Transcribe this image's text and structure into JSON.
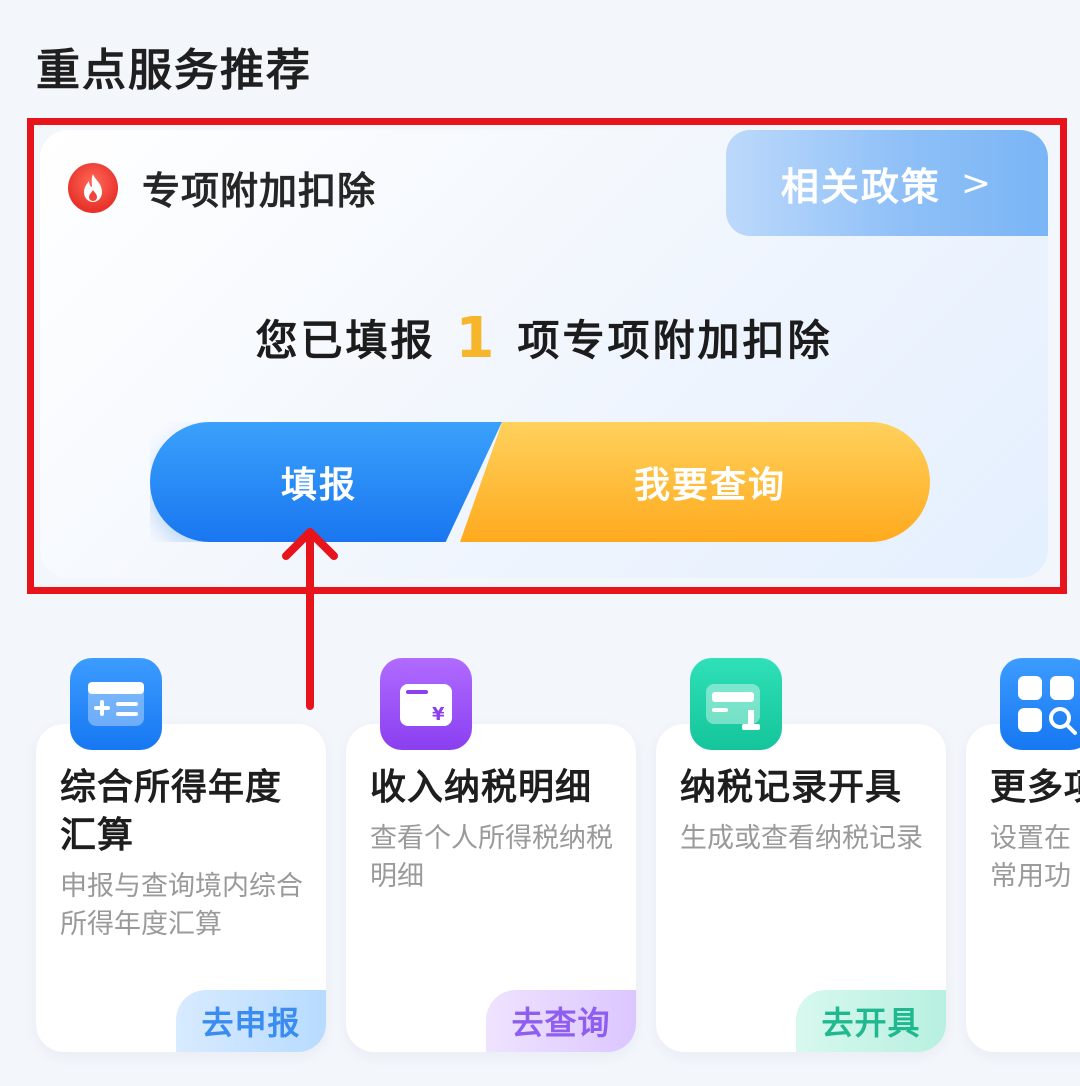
{
  "section": {
    "title": "重点服务推荐"
  },
  "feature": {
    "title": "专项附加扣除",
    "policy_label": "相关政策",
    "summary_prefix": "您已填报",
    "summary_count": "1",
    "summary_suffix": "项专项附加扣除",
    "fill_label": "填报",
    "query_label": "我要查询"
  },
  "services": [
    {
      "title": "综合所得年度汇算",
      "desc": "申报与查询境内综合所得年度汇算",
      "action": "去申报",
      "icon": "tax-report-icon"
    },
    {
      "title": "收入纳税明细",
      "desc": "查看个人所得税纳税明细",
      "action": "去查询",
      "icon": "income-detail-icon"
    },
    {
      "title": "纳税记录开具",
      "desc": "生成或查看纳税记录",
      "action": "去开具",
      "icon": "tax-record-icon"
    },
    {
      "title": "更多项",
      "desc": "设置在常用功",
      "action": "",
      "icon": "more-apps-icon"
    }
  ],
  "colors": {
    "highlight": "#e8141b",
    "fill_button": "#1976f0",
    "query_button": "#ffaa1e",
    "count": "#f7b52a"
  }
}
